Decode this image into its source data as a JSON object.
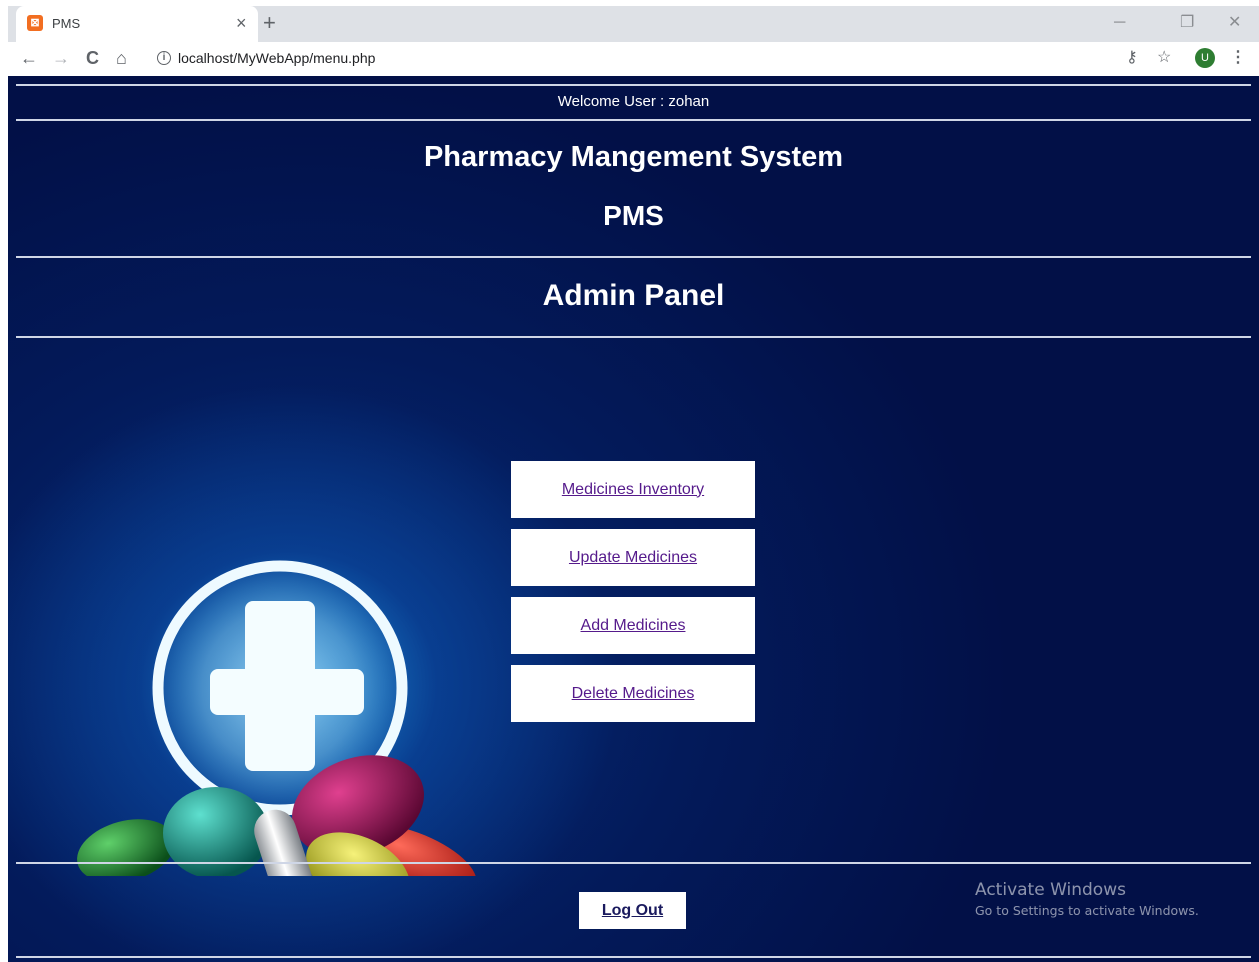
{
  "browser": {
    "tab_title": "PMS",
    "tab_favicon": "⊠",
    "tab_close": "×",
    "new_tab": "+",
    "back": "←",
    "forward": "→",
    "reload": "C",
    "home": "⌂",
    "info": "i",
    "url": "localhost/MyWebApp/menu.php",
    "key_icon": "⚷",
    "star_icon": "☆",
    "avatar": "U",
    "menu_icon": "⋮",
    "minimize": "─",
    "restore": "❐",
    "close": "✕"
  },
  "header": {
    "welcome": "Welcome User : zohan",
    "title": "Pharmacy Mangement System",
    "abbrev": "PMS",
    "panel": "Admin Panel"
  },
  "menu": {
    "items": [
      {
        "label": "Medicines Inventory"
      },
      {
        "label": "Update Medicines"
      },
      {
        "label": "Add Medicines"
      },
      {
        "label": "Delete Medicines"
      }
    ],
    "logout": "Log Out"
  },
  "watermark": {
    "line1": "Activate Windows",
    "line2": "Go to Settings to activate Windows."
  }
}
